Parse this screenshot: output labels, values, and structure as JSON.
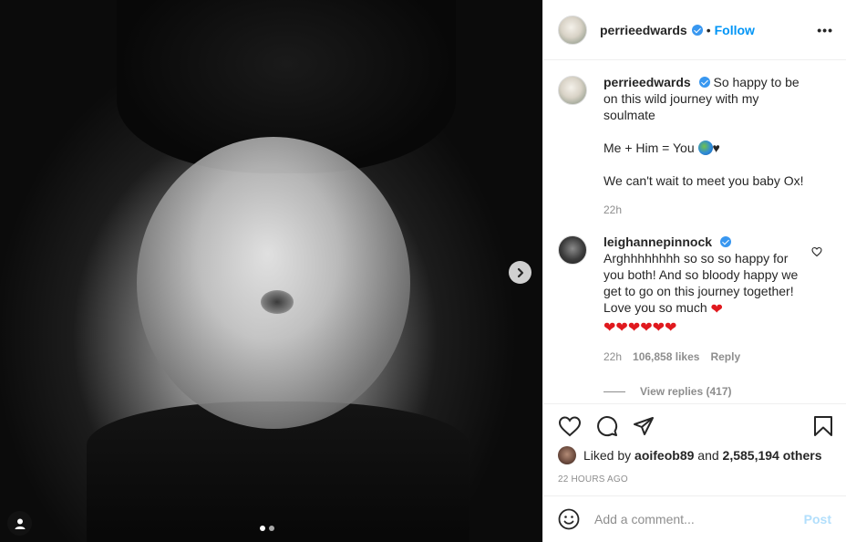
{
  "post": {
    "username": "perrieedwards",
    "separator": "•",
    "follow_label": "Follow",
    "more_label": "•••"
  },
  "caption": {
    "username": "perrieedwards",
    "line1": "So happy to be on this wild journey with my soulmate",
    "line2_prefix": "Me + Him = You",
    "line2_suffix": "♥",
    "line3": "We can't wait to meet you baby Ox!",
    "time": "22h"
  },
  "comment": {
    "username": "leighannepinnock",
    "text": "Arghhhhhhhh so so so happy for you both! And so bloody happy we get to go on this journey together! Love you so much",
    "hearts_line1": "❤",
    "hearts_line2": "❤❤❤❤❤❤",
    "time": "22h",
    "likes": "106,858 likes",
    "reply": "Reply",
    "view_replies": "View replies (417)"
  },
  "likes": {
    "prefix": "Liked by",
    "user": "aoifeob89",
    "and": "and",
    "others": "2,585,194 others"
  },
  "timestamp": "22 HOURS AGO",
  "add_comment": {
    "placeholder": "Add a comment...",
    "post_label": "Post"
  },
  "carousel": {
    "current": 1,
    "total": 2
  },
  "colors": {
    "accent": "#0095f6",
    "verified": "#3897f0",
    "muted": "#8e8e8e",
    "post_disabled": "#b2dffc",
    "heart": "#e0191e"
  },
  "icons": [
    "chevron-right-icon",
    "user-tag-icon",
    "heart-icon",
    "comment-icon",
    "share-icon",
    "bookmark-icon",
    "smile-icon",
    "more-icon",
    "verified-icon"
  ]
}
